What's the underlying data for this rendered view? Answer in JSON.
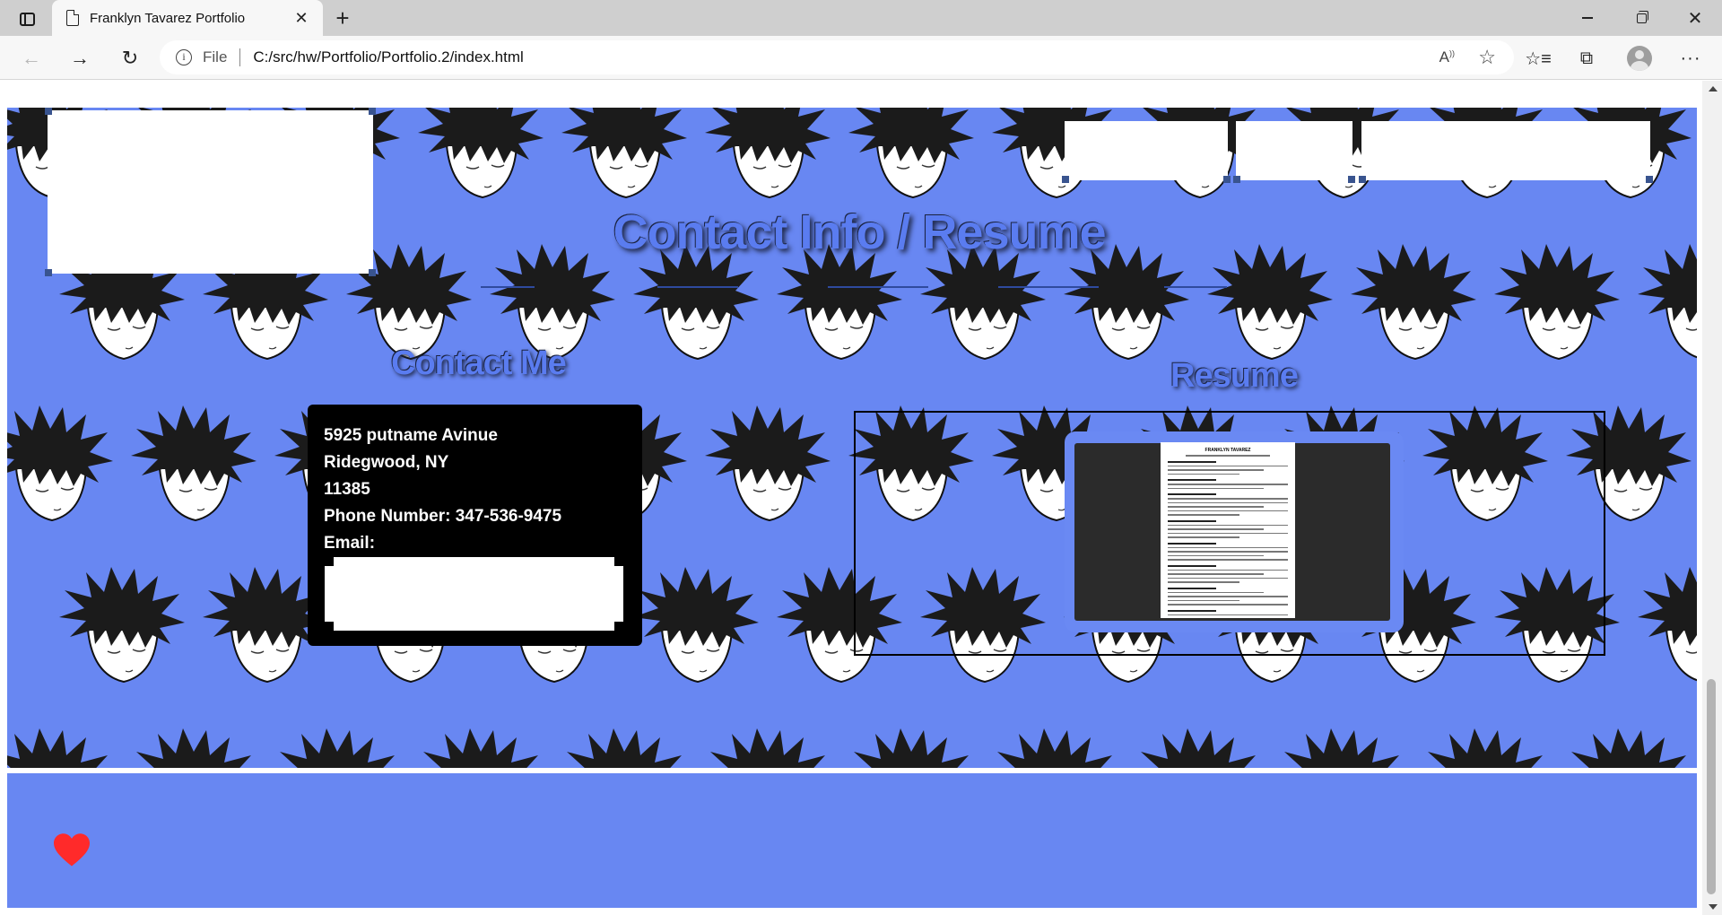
{
  "browser": {
    "tab_title": "Franklyn Tavarez Portfolio",
    "scheme": "File",
    "url": "C:/src/hw/Portfolio/Portfolio.2/index.html"
  },
  "page": {
    "title": "Contact Info / Resume",
    "contact_heading": "Contact Me",
    "resume_heading": "Resume",
    "contact": {
      "address_line1": "5925 putname Avinue",
      "address_line2": "Ridegwood, NY",
      "zip": "11385",
      "phone": "Phone Number: 347-536-9475",
      "email_label": "Email:"
    },
    "resume_preview_name": "FRANKLYN TAVAREZ"
  },
  "colors": {
    "page_background": "#6887f2",
    "heading_text": "#5a7cf0",
    "contact_card": "#000000",
    "heart": "#ff2a2a"
  },
  "icons": {
    "tab_actions": "tab-actions-icon",
    "page": "page-icon",
    "close": "close-icon",
    "new_tab": "plus-icon",
    "back": "back-arrow-icon",
    "forward": "forward-arrow-icon",
    "reload": "reload-icon",
    "info": "info-icon",
    "read_aloud": "read-aloud-icon",
    "favorite": "star-add-icon",
    "favorites": "favorites-icon",
    "collections": "collections-icon",
    "profile": "profile-avatar-icon",
    "more": "more-icon",
    "heart": "heart-icon"
  }
}
